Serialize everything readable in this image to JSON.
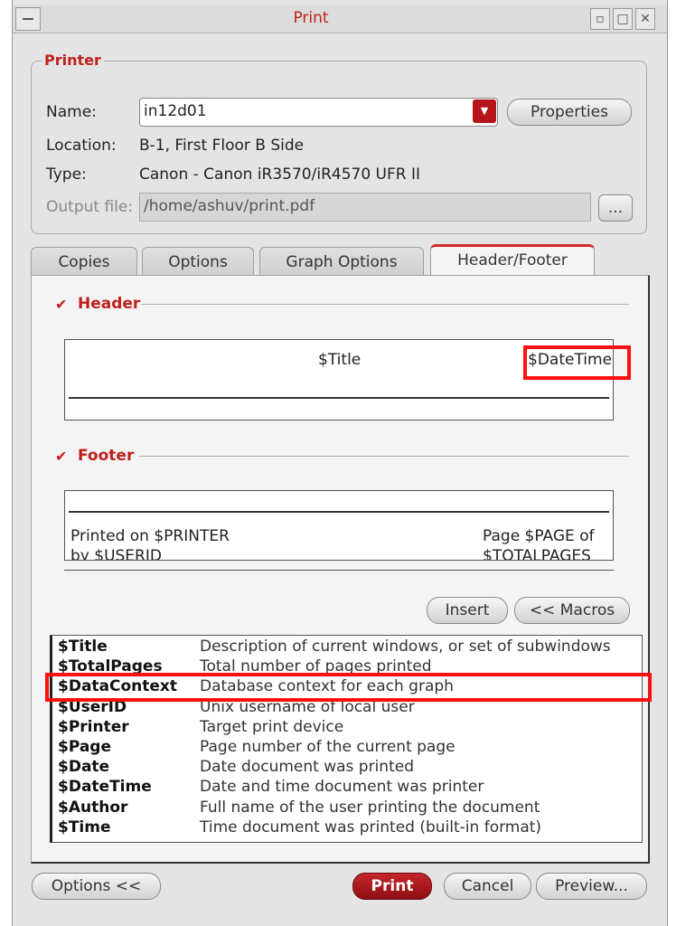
{
  "window": {
    "title": "Print"
  },
  "printer": {
    "legend": "Printer",
    "name_label": "Name:",
    "name_value": "in12d01",
    "properties_button": "Properties",
    "location_label": "Location:",
    "location_value": "B-1, First Floor B Side",
    "type_label": "Type:",
    "type_value": "Canon - Canon iR3570/iR4570 UFR II",
    "output_label": "Output file:",
    "output_value": "/home/ashuv/print.pdf",
    "browse_button": "..."
  },
  "tabs": [
    "Copies",
    "Options",
    "Graph Options",
    "Header/Footer"
  ],
  "active_tab": "Header/Footer",
  "header": {
    "label": "Header",
    "checked": true,
    "center_text": "$Title",
    "right_text": "$DateTime"
  },
  "footer": {
    "label": "Footer",
    "checked": true,
    "left_text": "Printed on $PRINTER",
    "left_text_2": "by $USERID",
    "right_text": "Page $PAGE of",
    "right_text_2": "$TOTALPAGES"
  },
  "buttons": {
    "insert": "Insert",
    "macros": "<< Macros",
    "options": "Options <<",
    "print": "Print",
    "cancel": "Cancel",
    "preview": "Preview..."
  },
  "macros": [
    {
      "key": "$Title",
      "desc": "Description of current windows, or set of subwindows"
    },
    {
      "key": "$TotalPages",
      "desc": "Total number of pages printed"
    },
    {
      "key": "$DataContext",
      "desc": "Database context for each graph"
    },
    {
      "key": "$UserID",
      "desc": "Unix username of local user"
    },
    {
      "key": "$Printer",
      "desc": "Target print device"
    },
    {
      "key": "$Page",
      "desc": "Page number of the current page"
    },
    {
      "key": "$Date",
      "desc": "Date document was printed"
    },
    {
      "key": "$DateTime",
      "desc": "Date and time document was printer"
    },
    {
      "key": "$Author",
      "desc": "Full name of the user printing the document"
    },
    {
      "key": "$Time",
      "desc": "Time document was printed (built-in format)"
    }
  ],
  "colors": {
    "accent": "#c0201c",
    "highlight": "#ff1010"
  }
}
